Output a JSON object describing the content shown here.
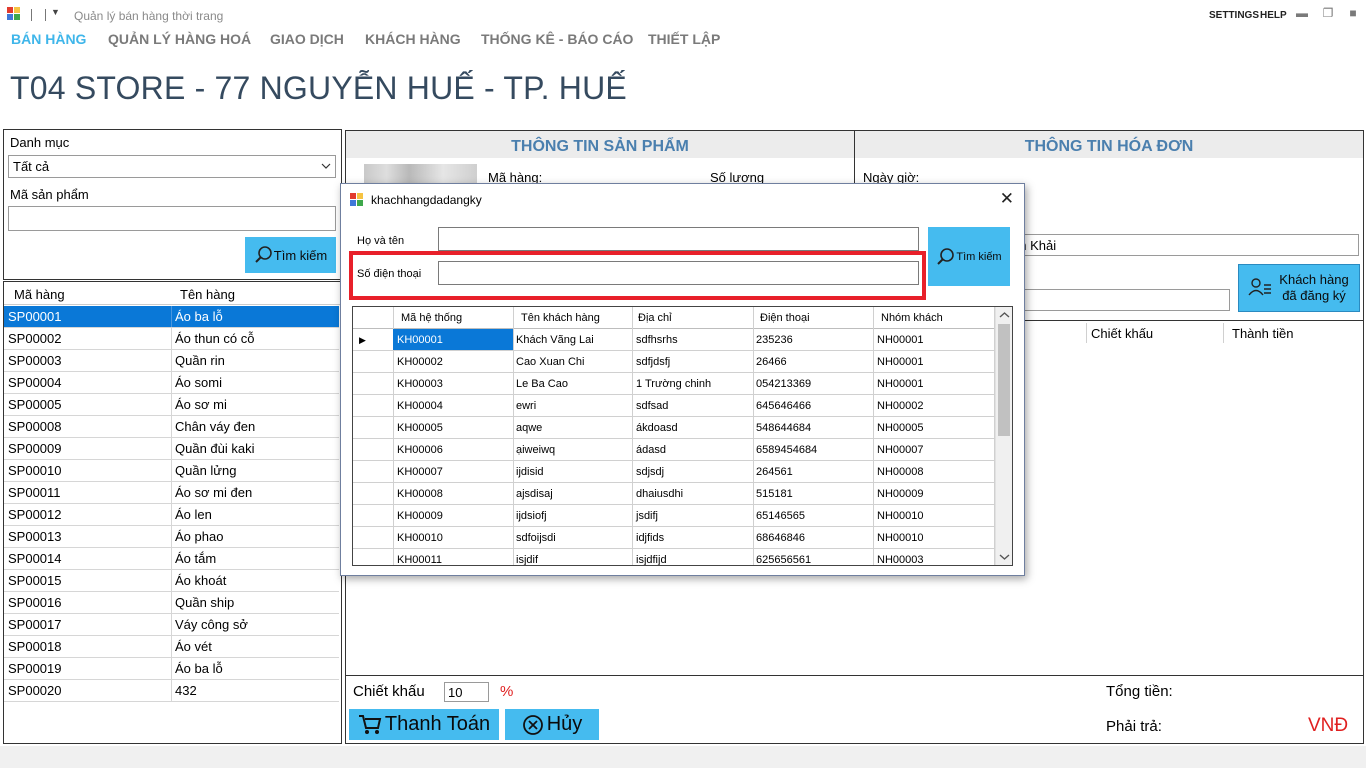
{
  "window": {
    "title": "Quản lý bán hàng thời trang",
    "settings": "SETTINGS",
    "help": "HELP"
  },
  "menu": [
    "BÁN HÀNG",
    "QUẢN LÝ HÀNG HOÁ",
    "GIAO DỊCH",
    "KHÁCH HÀNG",
    "THỐNG KÊ - BÁO CÁO",
    "THIẾT LẬP"
  ],
  "store_title": "T04 STORE - 77 NGUYỄN HUẾ - TP. HUẾ",
  "left": {
    "category_label": "Danh mục",
    "category_value": "Tất cả",
    "code_label": "Mã sản phẩm",
    "search_button": "Tìm kiếm"
  },
  "products": {
    "headers": [
      "Mã hàng",
      "Tên hàng"
    ],
    "rows": [
      [
        "SP00001",
        "Áo ba lỗ"
      ],
      [
        "SP00002",
        "Áo thun có cỗ"
      ],
      [
        "SP00003",
        "Quần rin"
      ],
      [
        "SP00004",
        "Áo somi"
      ],
      [
        "SP00005",
        "Áo sơ mi"
      ],
      [
        "SP00008",
        "Chân váy đen"
      ],
      [
        "SP00009",
        "Quần đùi kaki"
      ],
      [
        "SP00010",
        "Quần lửng"
      ],
      [
        "SP00011",
        "Áo sơ mi đen"
      ],
      [
        "SP00012",
        "Áo len"
      ],
      [
        "SP00013",
        "Áo phao"
      ],
      [
        "SP00014",
        "Áo tắm"
      ],
      [
        "SP00015",
        "Áo khoát"
      ],
      [
        "SP00016",
        "Quần ship"
      ],
      [
        "SP00017",
        "Váy công sở"
      ],
      [
        "SP00018",
        "Áo vét"
      ],
      [
        "SP00019",
        "Áo ba lỗ"
      ],
      [
        "SP00020",
        "432"
      ]
    ]
  },
  "product_info": {
    "title": "THÔNG TIN SẢN PHẨM",
    "code_label": "Mã hàng:",
    "qty_label": "Số lượng"
  },
  "invoice_info": {
    "title": "THÔNG TIN HÓA ĐƠN",
    "date_label": "Ngày giờ:",
    "customer_value": "nh Khải",
    "registered_button": "Khách hàng đã đăng ký"
  },
  "order": {
    "headers": [
      "Chiết khấu",
      "Thành tiền"
    ]
  },
  "bottom": {
    "discount_label": "Chiết khấu",
    "discount_value": "10",
    "percent": "%",
    "pay_button": "Thanh Toán",
    "cancel_button": "Hủy",
    "total_label": "Tổng tiền:",
    "payable_label": "Phải trả:",
    "currency": "VNĐ"
  },
  "dialog": {
    "title": "khachhangdadangky",
    "name_label": "Họ và tên",
    "phone_label": "Số điện thoại",
    "name_value": "",
    "phone_value": "",
    "search_button": "Tìm kiếm",
    "headers": [
      "Mã hệ thống",
      "Tên khách hàng",
      "Địa chỉ",
      "Điện thoại",
      "Nhóm khách"
    ],
    "rows": [
      [
        "KH00001",
        "Khách Vãng Lai",
        "sdfhsrhs",
        "235236",
        "NH00001"
      ],
      [
        "KH00002",
        "Cao Xuan Chi",
        "sdfjdsfj",
        "26466",
        "NH00001"
      ],
      [
        "KH00003",
        "Le Ba Cao",
        "1 Trường chinh",
        "054213369",
        "NH00001"
      ],
      [
        "KH00004",
        "ewri",
        "sdfsad",
        "645646466",
        "NH00002"
      ],
      [
        "KH00005",
        "aqwe",
        "ákdoasd",
        "548644684",
        "NH00005"
      ],
      [
        "KH00006",
        "ạiweiwq",
        "ádasd",
        "6589454684",
        "NH00007"
      ],
      [
        "KH00007",
        "ijdisid",
        "sdjsdj",
        "264561",
        "NH00008"
      ],
      [
        "KH00008",
        "ajsdisaj",
        "dhaiusdhi",
        "515181",
        "NH00009"
      ],
      [
        "KH00009",
        "ijdsiofj",
        "jsdifj",
        "65146565",
        "NH00010"
      ],
      [
        "KH00010",
        "sdfoijsdi",
        "idjfids",
        "68646846",
        "NH00010"
      ],
      [
        "KH00011",
        "isjdif",
        "isjdfijd",
        "625656561",
        "NH00003"
      ]
    ]
  },
  "colors": {
    "accent": "#45bbef",
    "selected": "#0a78d7",
    "highlight": "#e8202a",
    "title": "#354a5f",
    "panel_title": "#4a7fae"
  }
}
